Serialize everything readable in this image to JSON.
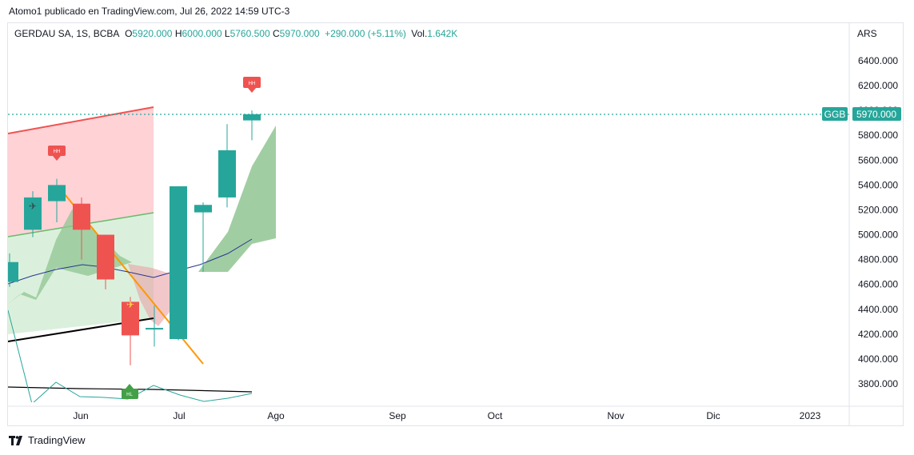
{
  "header": {
    "published": "Atomo1 publicado en TradingView.com, Jul 26, 2022 14:59 UTC-3"
  },
  "legend": {
    "symbol": "GERDAU SA, 1S, BCBA",
    "o_label": "O",
    "open": "5920.000",
    "h_label": "H",
    "high": "6000.000",
    "l_label": "L",
    "low": "5760.500",
    "c_label": "C",
    "close": "5970.000",
    "change": "+290.000 (+5.11%)",
    "vol_label": "Vol.",
    "volume": "1.642K"
  },
  "currency": "ARS",
  "footer": {
    "brand": "TradingView"
  },
  "colors": {
    "up": "#26a69a",
    "down": "#ef5350",
    "upper_band": "#ffcdd2",
    "lower_band": "#c8e6c9",
    "trend": "#ff9800"
  },
  "chart_data": {
    "type": "candlestick",
    "y_axis": {
      "ticks": [
        "6400.000",
        "6200.000",
        "6000.000",
        "5800.000",
        "5600.000",
        "5400.000",
        "5200.000",
        "5000.000",
        "4800.000",
        "4600.000",
        "4400.000",
        "4200.000",
        "4000.000",
        "3800.000"
      ]
    },
    "x_axis": {
      "ticks": [
        "Jun",
        "Jul",
        "Ago",
        "Sep",
        "Oct",
        "Nov",
        "Dic",
        "2023"
      ]
    },
    "candles": [
      {
        "o": 4620,
        "h": 4850,
        "l": 4580,
        "c": 4780
      },
      {
        "o": 5040,
        "h": 5350,
        "l": 4980,
        "c": 5300
      },
      {
        "o": 5270,
        "h": 5450,
        "l": 5100,
        "c": 5400
      },
      {
        "o": 5250,
        "h": 5300,
        "l": 4800,
        "c": 5040
      },
      {
        "o": 5000,
        "h": 5000,
        "l": 4560,
        "c": 4640
      },
      {
        "o": 4460,
        "h": 4500,
        "l": 3950,
        "c": 4190
      },
      {
        "o": 4240,
        "h": 4430,
        "l": 4100,
        "c": 4250
      },
      {
        "o": 4160,
        "h": 5390,
        "l": 4150,
        "c": 5390
      },
      {
        "o": 5180,
        "h": 5260,
        "l": 4700,
        "c": 5240
      },
      {
        "o": 5300,
        "h": 5890,
        "l": 5220,
        "c": 5680
      },
      {
        "o": 5920,
        "h": 6000,
        "l": 5760.5,
        "c": 5970
      }
    ],
    "last_price": {
      "symbol": "GGB",
      "value": "5970.000"
    },
    "markers": [
      {
        "label": "HH"
      },
      {
        "label": "HH"
      },
      {
        "label": "HL"
      }
    ]
  }
}
